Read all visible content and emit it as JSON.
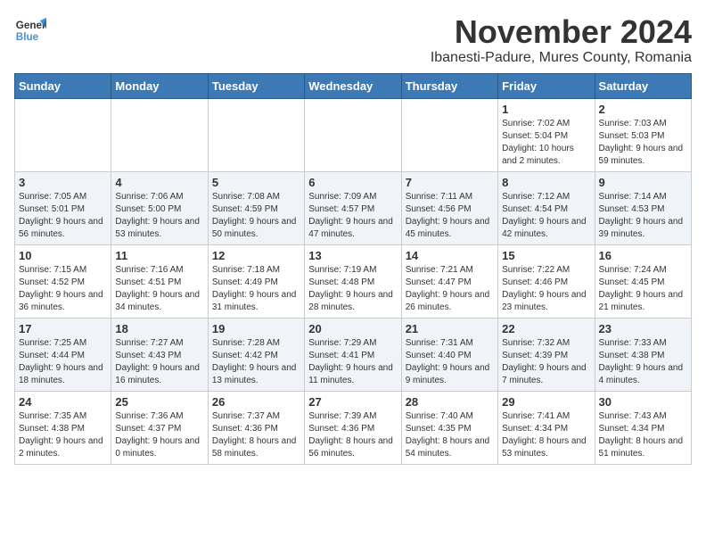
{
  "header": {
    "logo_general": "General",
    "logo_blue": "Blue",
    "month_year": "November 2024",
    "location": "Ibanesti-Padure, Mures County, Romania"
  },
  "weekdays": [
    "Sunday",
    "Monday",
    "Tuesday",
    "Wednesday",
    "Thursday",
    "Friday",
    "Saturday"
  ],
  "weeks": [
    [
      {
        "day": "",
        "info": ""
      },
      {
        "day": "",
        "info": ""
      },
      {
        "day": "",
        "info": ""
      },
      {
        "day": "",
        "info": ""
      },
      {
        "day": "",
        "info": ""
      },
      {
        "day": "1",
        "info": "Sunrise: 7:02 AM\nSunset: 5:04 PM\nDaylight: 10 hours and 2 minutes."
      },
      {
        "day": "2",
        "info": "Sunrise: 7:03 AM\nSunset: 5:03 PM\nDaylight: 9 hours and 59 minutes."
      }
    ],
    [
      {
        "day": "3",
        "info": "Sunrise: 7:05 AM\nSunset: 5:01 PM\nDaylight: 9 hours and 56 minutes."
      },
      {
        "day": "4",
        "info": "Sunrise: 7:06 AM\nSunset: 5:00 PM\nDaylight: 9 hours and 53 minutes."
      },
      {
        "day": "5",
        "info": "Sunrise: 7:08 AM\nSunset: 4:59 PM\nDaylight: 9 hours and 50 minutes."
      },
      {
        "day": "6",
        "info": "Sunrise: 7:09 AM\nSunset: 4:57 PM\nDaylight: 9 hours and 47 minutes."
      },
      {
        "day": "7",
        "info": "Sunrise: 7:11 AM\nSunset: 4:56 PM\nDaylight: 9 hours and 45 minutes."
      },
      {
        "day": "8",
        "info": "Sunrise: 7:12 AM\nSunset: 4:54 PM\nDaylight: 9 hours and 42 minutes."
      },
      {
        "day": "9",
        "info": "Sunrise: 7:14 AM\nSunset: 4:53 PM\nDaylight: 9 hours and 39 minutes."
      }
    ],
    [
      {
        "day": "10",
        "info": "Sunrise: 7:15 AM\nSunset: 4:52 PM\nDaylight: 9 hours and 36 minutes."
      },
      {
        "day": "11",
        "info": "Sunrise: 7:16 AM\nSunset: 4:51 PM\nDaylight: 9 hours and 34 minutes."
      },
      {
        "day": "12",
        "info": "Sunrise: 7:18 AM\nSunset: 4:49 PM\nDaylight: 9 hours and 31 minutes."
      },
      {
        "day": "13",
        "info": "Sunrise: 7:19 AM\nSunset: 4:48 PM\nDaylight: 9 hours and 28 minutes."
      },
      {
        "day": "14",
        "info": "Sunrise: 7:21 AM\nSunset: 4:47 PM\nDaylight: 9 hours and 26 minutes."
      },
      {
        "day": "15",
        "info": "Sunrise: 7:22 AM\nSunset: 4:46 PM\nDaylight: 9 hours and 23 minutes."
      },
      {
        "day": "16",
        "info": "Sunrise: 7:24 AM\nSunset: 4:45 PM\nDaylight: 9 hours and 21 minutes."
      }
    ],
    [
      {
        "day": "17",
        "info": "Sunrise: 7:25 AM\nSunset: 4:44 PM\nDaylight: 9 hours and 18 minutes."
      },
      {
        "day": "18",
        "info": "Sunrise: 7:27 AM\nSunset: 4:43 PM\nDaylight: 9 hours and 16 minutes."
      },
      {
        "day": "19",
        "info": "Sunrise: 7:28 AM\nSunset: 4:42 PM\nDaylight: 9 hours and 13 minutes."
      },
      {
        "day": "20",
        "info": "Sunrise: 7:29 AM\nSunset: 4:41 PM\nDaylight: 9 hours and 11 minutes."
      },
      {
        "day": "21",
        "info": "Sunrise: 7:31 AM\nSunset: 4:40 PM\nDaylight: 9 hours and 9 minutes."
      },
      {
        "day": "22",
        "info": "Sunrise: 7:32 AM\nSunset: 4:39 PM\nDaylight: 9 hours and 7 minutes."
      },
      {
        "day": "23",
        "info": "Sunrise: 7:33 AM\nSunset: 4:38 PM\nDaylight: 9 hours and 4 minutes."
      }
    ],
    [
      {
        "day": "24",
        "info": "Sunrise: 7:35 AM\nSunset: 4:38 PM\nDaylight: 9 hours and 2 minutes."
      },
      {
        "day": "25",
        "info": "Sunrise: 7:36 AM\nSunset: 4:37 PM\nDaylight: 9 hours and 0 minutes."
      },
      {
        "day": "26",
        "info": "Sunrise: 7:37 AM\nSunset: 4:36 PM\nDaylight: 8 hours and 58 minutes."
      },
      {
        "day": "27",
        "info": "Sunrise: 7:39 AM\nSunset: 4:36 PM\nDaylight: 8 hours and 56 minutes."
      },
      {
        "day": "28",
        "info": "Sunrise: 7:40 AM\nSunset: 4:35 PM\nDaylight: 8 hours and 54 minutes."
      },
      {
        "day": "29",
        "info": "Sunrise: 7:41 AM\nSunset: 4:34 PM\nDaylight: 8 hours and 53 minutes."
      },
      {
        "day": "30",
        "info": "Sunrise: 7:43 AM\nSunset: 4:34 PM\nDaylight: 8 hours and 51 minutes."
      }
    ]
  ]
}
